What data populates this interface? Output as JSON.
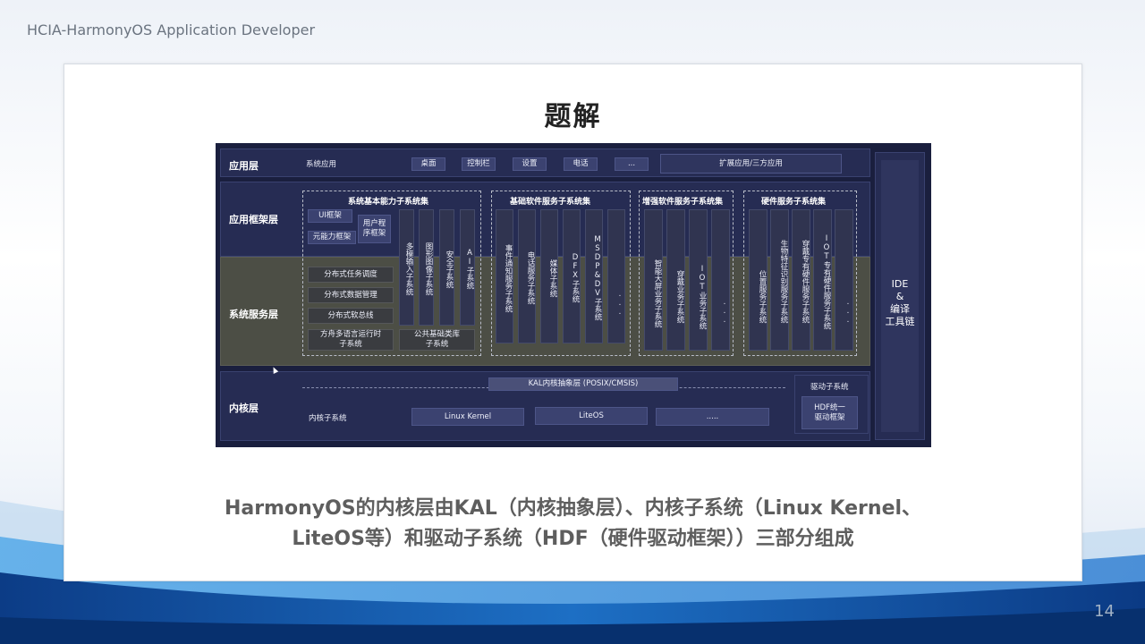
{
  "header": {
    "course": "HCIA-HarmonyOS Application Developer"
  },
  "slide": {
    "title": "题解",
    "page_number": "14",
    "caption_line1": "HarmonyOS的内核层由KAL（内核抽象层）、内核子系统（Linux Kernel、",
    "caption_line2": "LiteOS等）和驱动子系统（HDF（硬件驱动框架））三部分组成"
  },
  "arch": {
    "layers": {
      "app": "应用层",
      "framework": "应用框架层",
      "service": "系统服务层",
      "kernel": "内核层"
    },
    "app_layer": {
      "system_apps": "系统应用",
      "items": [
        "桌面",
        "控制栏",
        "设置",
        "电话",
        "..."
      ],
      "extended": "扩展应用/三方应用"
    },
    "groups": {
      "basic": {
        "title": "系统基本能力子系统集",
        "ui": "UI框架",
        "user_prog": "用户程序框架",
        "ability": "元能力框架",
        "dist_task": "分布式任务调度",
        "dist_data": "分布式数据管理",
        "dist_bus": "分布式软总线",
        "ark": "方舟多语言运行时子系统",
        "common_lib": "公共基础类库子系统",
        "columns": [
          "多模输入子系统",
          "图形图像子系统",
          "安全子系统",
          "AI子系统"
        ]
      },
      "software": {
        "title": "基础软件服务子系统集",
        "columns": [
          "事件通知服务子系统",
          "电话服务子系统",
          "媒体子系统",
          "DFX子系统",
          "MSDP&DV子系统",
          "..."
        ]
      },
      "enhanced": {
        "title": "增强软件服务子系统集",
        "columns": [
          "智能大屏业务子系统",
          "穿戴业务子系统",
          "IOT业务子系统",
          "..."
        ]
      },
      "hardware": {
        "title": "硬件服务子系统集",
        "columns": [
          "位置服务子系统",
          "生物特征识别服务子系统",
          "穿戴专有硬件服务子系统",
          "IOT专有硬件服务子系统",
          "..."
        ]
      }
    },
    "kernel_layer": {
      "kal": "KAL内核抽象层 (POSIX/CMSIS)",
      "subsystem": "内核子系统",
      "items": [
        "Linux Kernel",
        "LiteOS",
        "....."
      ],
      "driver": "驱动子系统",
      "hdf": "HDF统一驱动框架"
    },
    "ide": {
      "line1": "IDE",
      "line2": "&",
      "line3": "编译",
      "line4": "工具链"
    }
  }
}
